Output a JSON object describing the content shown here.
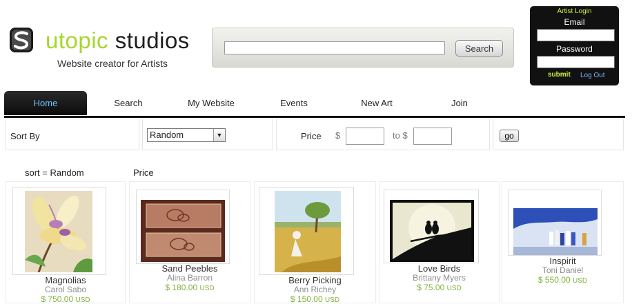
{
  "header": {
    "logo_word_1": "utopic",
    "logo_word_2": "studios",
    "tagline": "Website creator for Artists"
  },
  "search": {
    "value": "",
    "button_label": "Search"
  },
  "login": {
    "title": "Artist Login",
    "email_label": "Email",
    "password_label": "Password",
    "submit_label": "submit",
    "logout_label": "Log Out"
  },
  "nav": {
    "tabs": [
      {
        "label": "Home",
        "active": true
      },
      {
        "label": "Search"
      },
      {
        "label": "My Website"
      },
      {
        "label": "Events"
      },
      {
        "label": "New Art"
      },
      {
        "label": "Join"
      }
    ]
  },
  "filters": {
    "sort_label": "Sort By",
    "sort_value": "Random",
    "price_label": "Price",
    "currency_symbol": "$",
    "to_label": "to $",
    "min_value": "",
    "max_value": "",
    "go_label": "go"
  },
  "status": {
    "sort_text": "sort = Random",
    "price_text": "Price"
  },
  "products": [
    {
      "title": "Magnolias",
      "artist": "Carol Sabo",
      "price": "$ 750.00",
      "currency": "USD"
    },
    {
      "title": "Sand Peebles",
      "artist": "Alina Barron",
      "price": "$ 180.00",
      "currency": "USD"
    },
    {
      "title": "Berry Picking",
      "artist": "Ann Richey",
      "price": "$ 150.00",
      "currency": "USD"
    },
    {
      "title": "Love Birds",
      "artist": "Brittany Myers",
      "price": "$ 75.00",
      "currency": "USD"
    },
    {
      "title": "Inspirit",
      "artist": "Toni Daniel",
      "price": "$ 550.00",
      "currency": "USD"
    }
  ],
  "colors": {
    "brand_green": "#a6d62c",
    "price_green": "#7fb23a",
    "active_tab_text": "#6ec4ff",
    "login_accent": "#c9f04a"
  }
}
